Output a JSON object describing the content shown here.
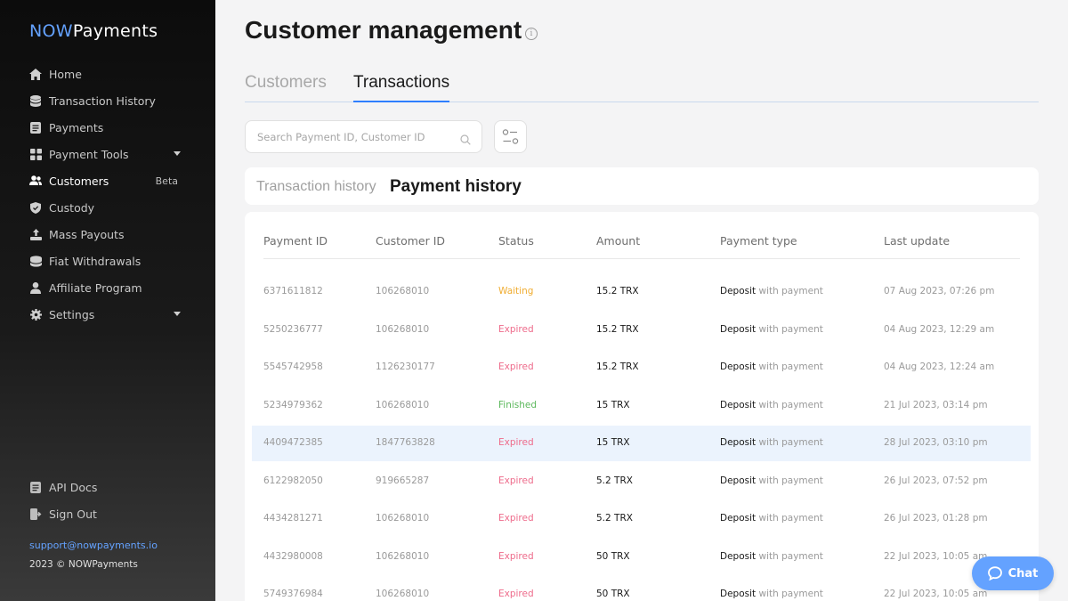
{
  "brand": {
    "now": "NOW",
    "rest": "Payments"
  },
  "sidebar": {
    "items": [
      {
        "label": "Home",
        "icon": "home-icon"
      },
      {
        "label": "Transaction History",
        "icon": "database-icon"
      },
      {
        "label": "Payments",
        "icon": "document-icon"
      },
      {
        "label": "Payment Tools",
        "icon": "grid-icon"
      },
      {
        "label": "Customers",
        "icon": "users-icon",
        "badge": "Beta"
      },
      {
        "label": "Custody",
        "icon": "shield-icon"
      },
      {
        "label": "Mass Payouts",
        "icon": "upload-icon"
      },
      {
        "label": "Fiat Withdrawals",
        "icon": "coins-icon"
      },
      {
        "label": "Affiliate Program",
        "icon": "user-icon"
      },
      {
        "label": "Settings",
        "icon": "gear-icon"
      }
    ],
    "bottom": [
      {
        "label": "API Docs",
        "icon": "document-icon"
      },
      {
        "label": "Sign Out",
        "icon": "sign-out-icon"
      }
    ],
    "support_email": "support@nowpayments.io",
    "copyright": "2023 © NOWPayments"
  },
  "header": {
    "title": "Customer management"
  },
  "tabs": {
    "customers": "Customers",
    "transactions": "Transactions"
  },
  "search": {
    "placeholder": "Search Payment ID, Customer ID"
  },
  "subtabs": {
    "transaction_history": "Transaction history",
    "payment_history": "Payment history"
  },
  "table": {
    "columns": [
      "Payment ID",
      "Customer ID",
      "Status",
      "Amount",
      "Payment type",
      "Last update"
    ],
    "rows": [
      {
        "payment_id": "6371611812",
        "customer_id": "106268010",
        "status": "Waiting",
        "amount": "15.2 TRX",
        "type_main": "Deposit",
        "type_rest": " with payment",
        "updated": "07 Aug 2023, 07:26 pm"
      },
      {
        "payment_id": "5250236777",
        "customer_id": "106268010",
        "status": "Expired",
        "amount": "15.2 TRX",
        "type_main": "Deposit",
        "type_rest": " with payment",
        "updated": "04 Aug 2023, 12:29 am"
      },
      {
        "payment_id": "5545742958",
        "customer_id": "1126230177",
        "status": "Expired",
        "amount": "15.2 TRX",
        "type_main": "Deposit",
        "type_rest": " with payment",
        "updated": "04 Aug 2023, 12:24 am"
      },
      {
        "payment_id": "5234979362",
        "customer_id": "106268010",
        "status": "Finished",
        "amount": "15 TRX",
        "type_main": "Deposit",
        "type_rest": " with payment",
        "updated": "21 Jul 2023, 03:14 pm"
      },
      {
        "payment_id": "4409472385",
        "customer_id": "1847763828",
        "status": "Expired",
        "amount": "15 TRX",
        "type_main": "Deposit",
        "type_rest": " with payment",
        "updated": "28 Jul 2023, 03:10 pm"
      },
      {
        "payment_id": "6122982050",
        "customer_id": "919665287",
        "status": "Expired",
        "amount": "5.2 TRX",
        "type_main": "Deposit",
        "type_rest": " with payment",
        "updated": "26 Jul 2023, 07:52 pm"
      },
      {
        "payment_id": "4434281271",
        "customer_id": "106268010",
        "status": "Expired",
        "amount": "5.2 TRX",
        "type_main": "Deposit",
        "type_rest": " with payment",
        "updated": "26 Jul 2023, 01:28 pm"
      },
      {
        "payment_id": "4432980008",
        "customer_id": "106268010",
        "status": "Expired",
        "amount": "50 TRX",
        "type_main": "Deposit",
        "type_rest": " with payment",
        "updated": "22 Jul 2023, 10:05 am"
      },
      {
        "payment_id": "5749376984",
        "customer_id": "106268010",
        "status": "Expired",
        "amount": "50 TRX",
        "type_main": "Deposit",
        "type_rest": " with payment",
        "updated": "22 Jul 2023, 10:05 am"
      }
    ]
  },
  "status_colors": {
    "Waiting": "#f0ad32",
    "Expired": "#ee6b8b",
    "Finished": "#5cb85c"
  },
  "colors": {
    "accent": "#64a2ff",
    "highlight_row": "#ebf3fd"
  },
  "chat": {
    "label": "Chat"
  }
}
